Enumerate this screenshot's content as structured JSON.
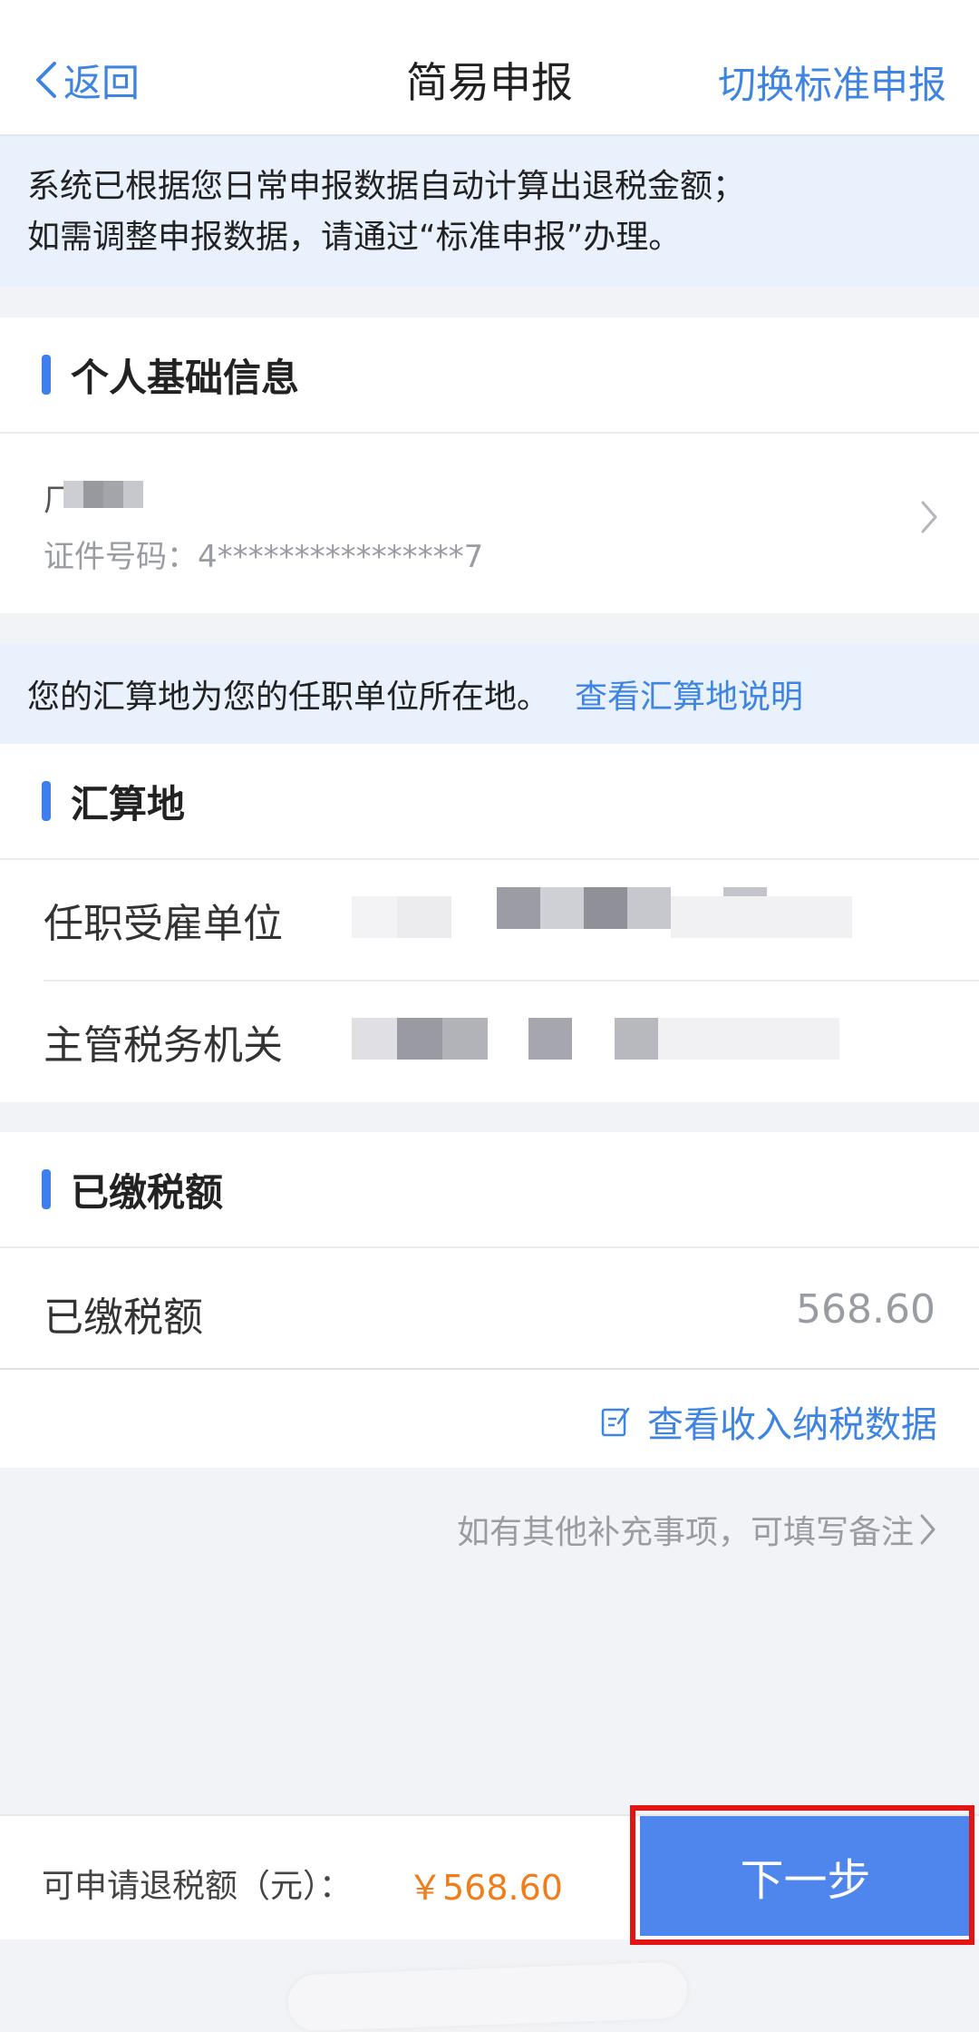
{
  "nav": {
    "back_label": "返回",
    "title": "简易申报",
    "switch_label": "切换标准申报"
  },
  "notice": {
    "line1": "系统已根据您日常申报数据自动计算出退税金额；",
    "line2": "如需调整申报数据，请通过“标准申报”办理。"
  },
  "personal": {
    "section_title": "个人基础信息",
    "name_prefix": "厂",
    "id_line": "证件号码：4****************7",
    "chevron_icon": "chevron-right-icon"
  },
  "settlement_notice": {
    "text": "您的汇算地为您的任职单位所在地。",
    "link": "查看汇算地说明"
  },
  "settlement": {
    "section_title": "汇算地",
    "employer_label": "任职受雇单位",
    "tax_office_label": "主管税务机关"
  },
  "paid_tax": {
    "section_title": "已缴税额",
    "label": "已缴税额",
    "value": "568.60",
    "view_data_label": "查看收入纳税数据",
    "view_data_icon": "edit-note-icon"
  },
  "remark": {
    "label": "如有其他补充事项，可填写备注"
  },
  "bottom": {
    "refund_label": "可申请退税额（元）：",
    "refund_value": "￥568.60",
    "next_label": "下一步"
  },
  "colors": {
    "accent": "#3e84e0",
    "button": "#4f86ee",
    "amount": "#f07d1c",
    "banner_bg": "#e8f1fc",
    "highlight": "#e21414"
  }
}
